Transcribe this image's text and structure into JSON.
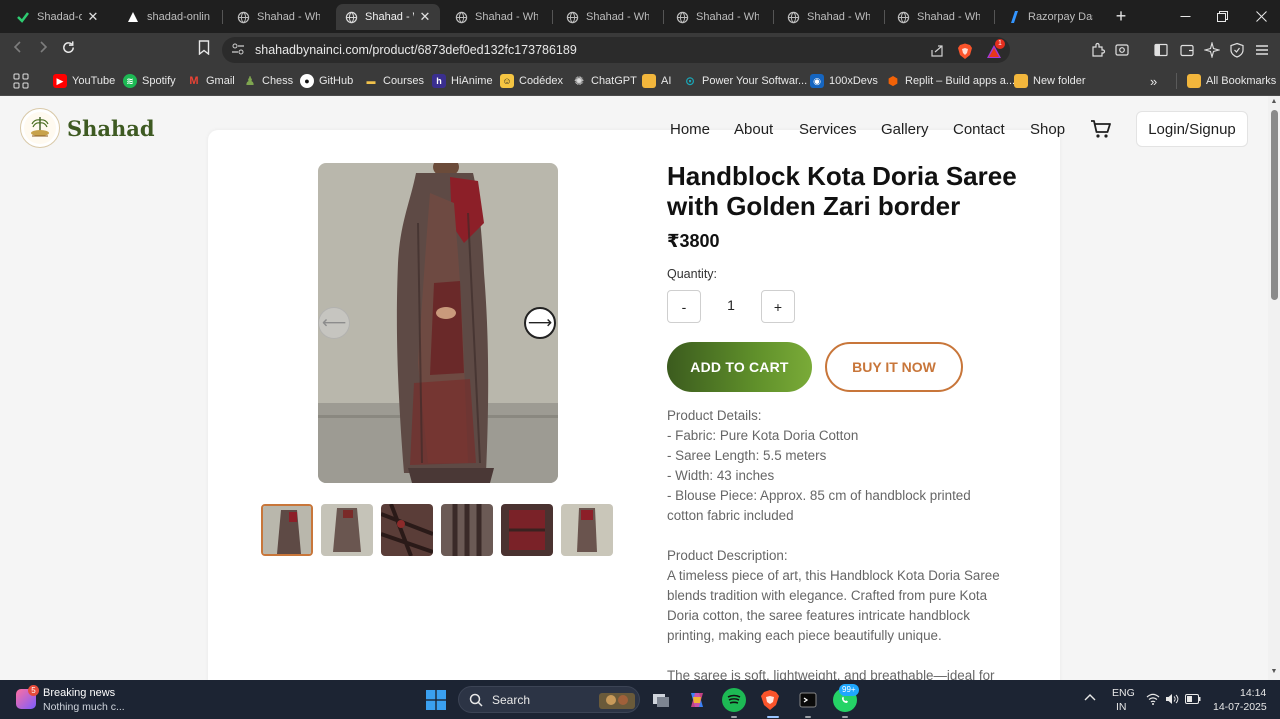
{
  "browser": {
    "tabs": [
      {
        "title": "Shadad-online",
        "active": false,
        "has_close": true
      },
      {
        "title": "shadad-online-s",
        "active": false,
        "has_close": false
      },
      {
        "title": "Shahad - Where",
        "active": false,
        "has_close": false
      },
      {
        "title": "Shahad - Wh",
        "active": true,
        "has_close": true
      },
      {
        "title": "Shahad - Where",
        "active": false,
        "has_close": false
      },
      {
        "title": "Shahad - Where",
        "active": false,
        "has_close": false
      },
      {
        "title": "Shahad - Where",
        "active": false,
        "has_close": false
      },
      {
        "title": "Shahad - Where",
        "active": false,
        "has_close": false
      },
      {
        "title": "Shahad - Where",
        "active": false,
        "has_close": false
      },
      {
        "title": "Razorpay Dashb",
        "active": false,
        "has_close": false
      }
    ],
    "url": "shahadbynainci.com/product/6873def0ed132fc173786189",
    "shield_count": "1",
    "bookmarks": [
      {
        "label": "YouTube",
        "icon": "youtube-icon",
        "color": "#ff0000"
      },
      {
        "label": "Spotify",
        "icon": "spotify-icon",
        "color": "#1db954"
      },
      {
        "label": "Gmail",
        "icon": "gmail-icon",
        "color": "#ea4335"
      },
      {
        "label": "Chess",
        "icon": "chess-icon",
        "color": "#7fa650"
      },
      {
        "label": "GitHub",
        "icon": "github-icon",
        "color": "#ffffff"
      },
      {
        "label": "Courses",
        "icon": "courses-icon",
        "color": "#f0c14b"
      },
      {
        "label": "HiAnime",
        "icon": "hianime-icon",
        "color": "#5a4bd6"
      },
      {
        "label": "Codédex",
        "icon": "codedex-icon",
        "color": "#f5c542"
      },
      {
        "label": "ChatGPT",
        "icon": "chatgpt-icon",
        "color": "#cccccc"
      },
      {
        "label": "AI",
        "icon": "folder-icon",
        "color": "#f2b63c"
      },
      {
        "label": "Power Your Softwar...",
        "icon": "power-icon",
        "color": "#1aa6b7"
      },
      {
        "label": "100xDevs",
        "icon": "100xdevs-icon",
        "color": "#1565c0"
      },
      {
        "label": "Replit – Build apps a...",
        "icon": "replit-icon",
        "color": "#f26207"
      },
      {
        "label": "New folder",
        "icon": "folder-icon",
        "color": "#f2b63c"
      }
    ],
    "all_bookmarks": "All Bookmarks"
  },
  "site": {
    "brand": "Shahad",
    "nav": [
      "Home",
      "About",
      "Services",
      "Gallery",
      "Contact",
      "Shop"
    ],
    "login": "Login/Signup",
    "colors": {
      "primary_green": "#4a6f22",
      "accent_orange": "#c8763a"
    }
  },
  "product": {
    "title": "Handblock Kota Doria Saree with Golden Zari border",
    "price": "₹3800",
    "quantity_label": "Quantity:",
    "quantity": "1",
    "minus": "-",
    "plus": "+",
    "add_to_cart": "ADD TO CART",
    "buy_now": "BUY IT NOW",
    "details_heading": "Product Details:",
    "details": [
      "- Fabric: Pure Kota Doria Cotton",
      "- Saree Length: 5.5 meters",
      "- Width: 43 inches",
      "- Blouse Piece: Approx. 85 cm of handblock printed",
      "cotton fabric included"
    ],
    "description_heading": "Product Description:",
    "description": [
      "A timeless piece of art, this Handblock Kota Doria Saree",
      "blends tradition with elegance. Crafted from pure Kota",
      "Doria cotton, the saree features intricate handblock",
      "printing, making each piece beautifully unique."
    ],
    "extra": "The saree is soft, lightweight, and breathable—ideal for",
    "thumbnail_count": 6,
    "selected_thumbnail": 1
  },
  "taskbar": {
    "news_title": "Breaking news",
    "news_sub": "Nothing much c...",
    "news_badge": "5",
    "search": "Search",
    "whatsapp_badge": "99+",
    "lang": "ENG",
    "region": "IN",
    "time": "14:14",
    "date": "14-07-2025"
  }
}
